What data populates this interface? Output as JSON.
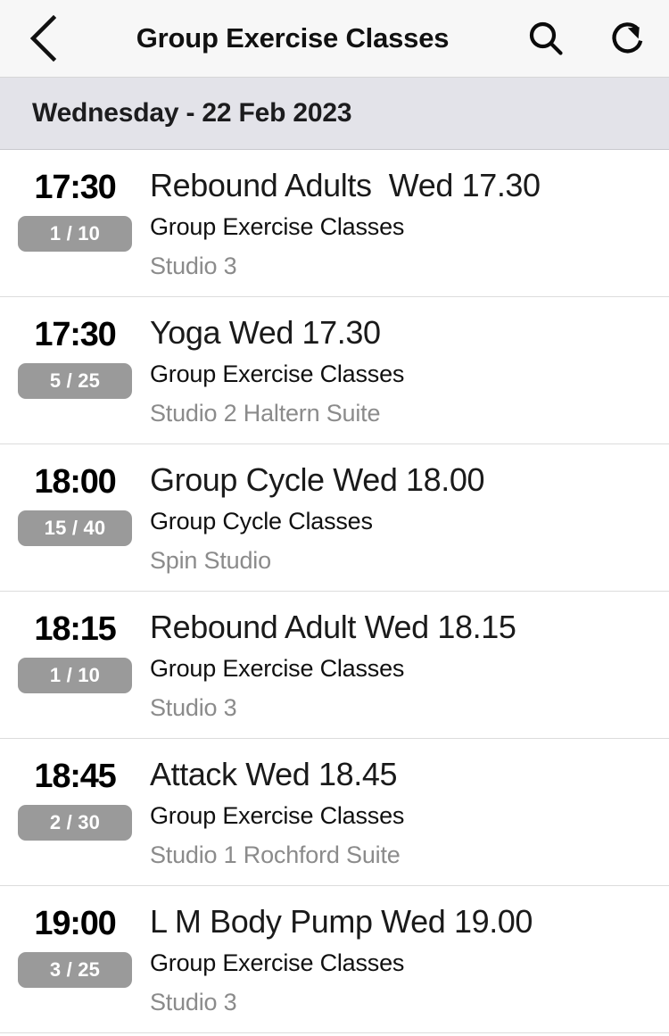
{
  "header": {
    "title": "Group Exercise Classes",
    "back_icon": "chevron-left-icon",
    "search_icon": "search-icon",
    "refresh_icon": "refresh-icon"
  },
  "date_section": {
    "label": "Wednesday - 22 Feb 2023"
  },
  "colors": {
    "navbar_bg": "#f7f7f7",
    "date_bar_bg": "#e3e3e9",
    "badge_bg": "#9a9a9a",
    "badge_text": "#ffffff",
    "title_text": "#1a1a1a",
    "category_text": "#101010",
    "location_text": "#8b8b8b",
    "divider": "#dcdcdc"
  },
  "classes": [
    {
      "time": "17:30",
      "booking": "1 / 10",
      "title": "Rebound Adults  Wed 17.30",
      "category": "Group Exercise Classes",
      "location": "Studio 3"
    },
    {
      "time": "17:30",
      "booking": "5 / 25",
      "title": "Yoga Wed 17.30",
      "category": "Group Exercise Classes",
      "location": "Studio 2 Haltern Suite"
    },
    {
      "time": "18:00",
      "booking": "15 / 40",
      "title": "Group Cycle Wed 18.00",
      "category": "Group Cycle Classes",
      "location": "Spin Studio"
    },
    {
      "time": "18:15",
      "booking": "1 / 10",
      "title": "Rebound Adult Wed 18.15",
      "category": "Group Exercise Classes",
      "location": "Studio 3"
    },
    {
      "time": "18:45",
      "booking": "2 / 30",
      "title": "Attack Wed 18.45",
      "category": "Group Exercise Classes",
      "location": "Studio 1 Rochford Suite"
    },
    {
      "time": "19:00",
      "booking": "3 / 25",
      "title": "L M Body Pump Wed 19.00",
      "category": "Group Exercise Classes",
      "location": "Studio 3"
    }
  ]
}
